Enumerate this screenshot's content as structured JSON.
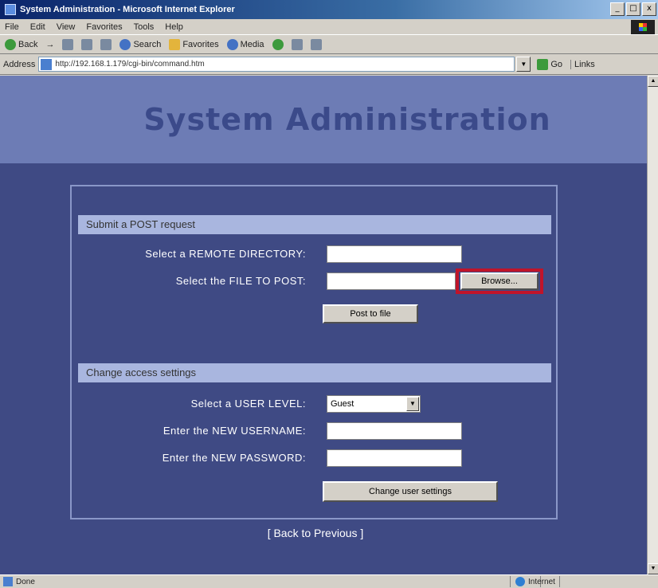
{
  "window": {
    "title": "System Administration - Microsoft Internet Explorer",
    "minimize": "_",
    "maximize": "□",
    "close": "x"
  },
  "menubar": [
    "File",
    "Edit",
    "View",
    "Favorites",
    "Tools",
    "Help"
  ],
  "toolbar": {
    "back": "Back",
    "forward": "→",
    "search": "Search",
    "favorites": "Favorites",
    "media": "Media"
  },
  "address": {
    "label": "Address",
    "url": "http://192.168.1.179/cgi-bin/command.htm",
    "go": "Go",
    "links": "Links"
  },
  "page": {
    "heading": "System Administration",
    "post_section": {
      "title": "Submit a POST request",
      "remote_dir_label": "Select a REMOTE DIRECTORY:",
      "remote_dir_value": "",
      "file_label": "Select the FILE TO POST:",
      "file_value": "",
      "browse_label": "Browse...",
      "post_button": "Post to file"
    },
    "access_section": {
      "title": "Change access settings",
      "user_level_label": "Select a USER LEVEL:",
      "user_level_value": "Guest",
      "username_label": "Enter the NEW USERNAME:",
      "username_value": "",
      "password_label": "Enter the NEW PASSWORD:",
      "password_value": "",
      "change_button": "Change user settings"
    },
    "back_link": "[  Back to Previous  ]"
  },
  "status": {
    "text": "Done",
    "zone": "Internet"
  },
  "colors": {
    "page_bg": "#3f4a84",
    "header_band": "#6d7cb5",
    "heading_text": "#3b4a8a",
    "section_bar": "#a9b6df",
    "highlight_border": "#c0142a"
  }
}
